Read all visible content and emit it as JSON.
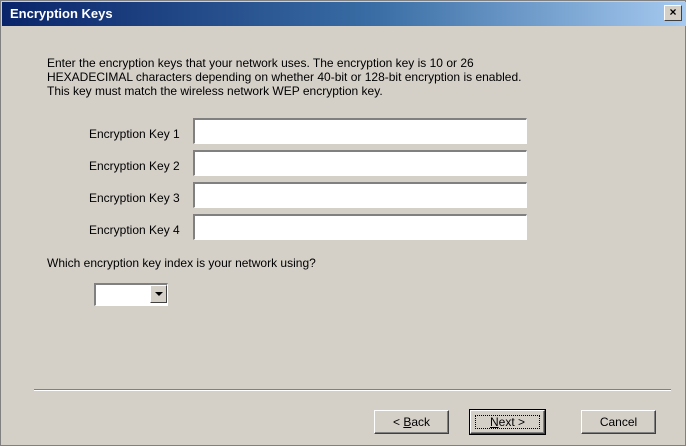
{
  "window": {
    "title": "Encryption Keys",
    "close_glyph": "×"
  },
  "intro": {
    "line1": "Enter the encryption keys that your network uses.  The encryption key is 10 or 26",
    "line2": "HEXADECIMAL characters depending on whether 40-bit or 128-bit encryption is enabled.",
    "line3": "This key must match the wireless network WEP encryption key."
  },
  "keys": [
    {
      "label": "Encryption Key 1",
      "value": ""
    },
    {
      "label": "Encryption Key 2",
      "value": ""
    },
    {
      "label": "Encryption Key 3",
      "value": ""
    },
    {
      "label": "Encryption Key 4",
      "value": ""
    }
  ],
  "index_question": "Which encryption key index is your network using?",
  "index_select": {
    "value": ""
  },
  "buttons": {
    "back_prefix": "< ",
    "back_mnemonic": "B",
    "back_rest": "ack",
    "next_mnemonic": "N",
    "next_rest": "ext >",
    "cancel": "Cancel"
  },
  "colors": {
    "face": "#d4d0c8",
    "title_start": "#0a246a",
    "title_end": "#a6caf0"
  }
}
